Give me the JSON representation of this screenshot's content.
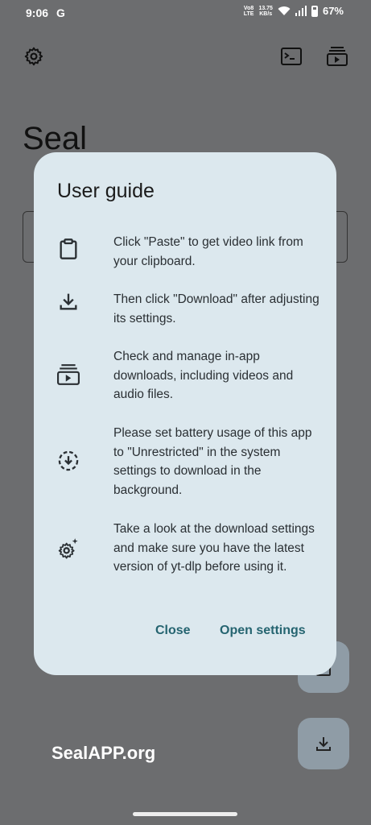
{
  "status_bar": {
    "time": "9:06",
    "google_icon": "G",
    "network_label_top": "Vo8",
    "network_label_bottom": "LTE",
    "speed_value": "13.75",
    "speed_unit": "KB/s",
    "battery": "67%"
  },
  "app": {
    "title": "Seal"
  },
  "dialog": {
    "title": "User guide",
    "items": [
      {
        "icon": "clipboard-icon",
        "text": "Click \"Paste\" to get video link from your clipboard."
      },
      {
        "icon": "download-icon",
        "text": "Then click \"Download\" after adjusting its settings."
      },
      {
        "icon": "subscriptions-icon",
        "text": "Check and manage in-app downloads, including videos and audio files."
      },
      {
        "icon": "battery-download-icon",
        "text": "Please set battery usage of this app to \"Unrestricted\" in the system settings to download in the background."
      },
      {
        "icon": "settings-sparkle-icon",
        "text": "Take a look at the download settings and make sure you have the latest version of yt-dlp before using it."
      }
    ],
    "close_label": "Close",
    "open_settings_label": "Open settings"
  },
  "watermark": "SealAPP.org"
}
